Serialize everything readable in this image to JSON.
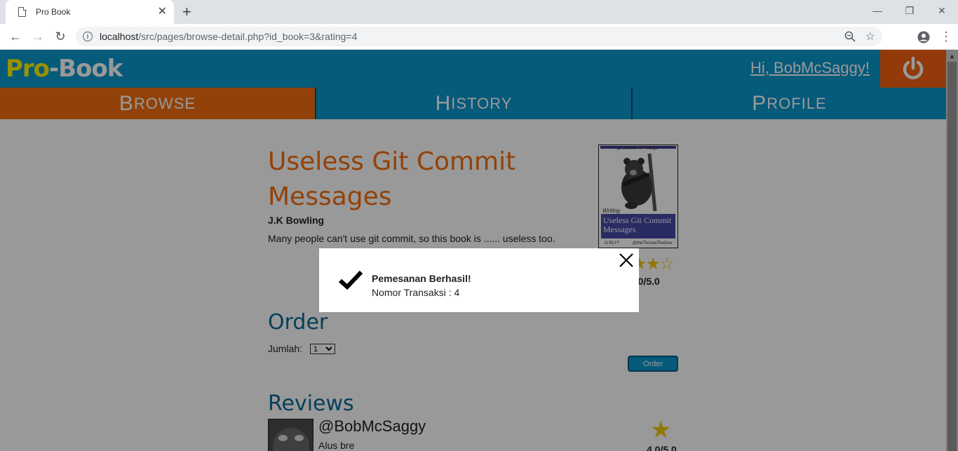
{
  "browser": {
    "tab_title": "Pro Book",
    "tab_close": "✕",
    "new_tab": "+",
    "url_host": "localhost",
    "url_path": "/src/pages/browse-detail.php?id_book=3&rating=4"
  },
  "header": {
    "logo_pro": "Pro",
    "logo_book": "-Book",
    "greeting": "Hi, BobMcSaggy!"
  },
  "nav": {
    "browse": {
      "initial": "B",
      "rest": "ROWSE"
    },
    "history": {
      "initial": "H",
      "rest": "ISTORY"
    },
    "profile": {
      "initial": "P",
      "rest": "ROFILE"
    }
  },
  "book": {
    "title": "Useless Git Commit Messages",
    "author": "J.K Bowling",
    "description": "Many people can't use git commit, so this book is ...... useless too.",
    "rating_text": "4.0/5.0",
    "rating_value": 4,
    "rating_max": 5,
    "cover": {
      "tagline": "git commit -m \"Things\"",
      "writing": "Writing",
      "band_title": "Useless Git Commit Messages",
      "publisher": "O RLY?",
      "author": "@theThriseaTheOne"
    }
  },
  "order": {
    "heading": "Order",
    "jumlah_label": "Jumlah:",
    "selected_qty": "1",
    "button_label": "Order"
  },
  "reviews": {
    "heading": "Reviews",
    "items": [
      {
        "username": "@BobMcSaggy",
        "comment": "Alus bre",
        "score": "4.0/5.0"
      }
    ]
  },
  "modal": {
    "title": "Pemesanan Berhasil!",
    "subtitle": "Nomor Transaksi : 4"
  },
  "colors": {
    "header_blue": "#0a96cc",
    "accent_orange": "#f36f0f",
    "logo_yellow": "#fff200",
    "star_gold": "#f3c60f"
  }
}
